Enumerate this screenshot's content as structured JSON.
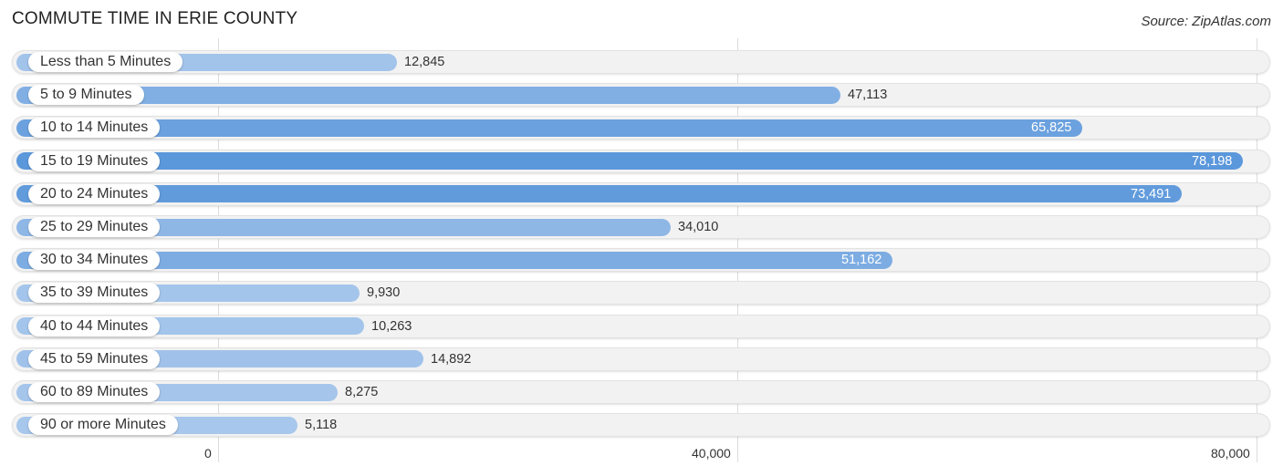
{
  "header": {
    "title": "COMMUTE TIME IN ERIE COUNTY",
    "source": "Source: ZipAtlas.com"
  },
  "chart_data": {
    "type": "bar",
    "orientation": "horizontal",
    "title": "COMMUTE TIME IN ERIE COUNTY",
    "xlabel": "",
    "ylabel": "",
    "categories": [
      "Less than 5 Minutes",
      "5 to 9 Minutes",
      "10 to 14 Minutes",
      "15 to 19 Minutes",
      "20 to 24 Minutes",
      "25 to 29 Minutes",
      "30 to 34 Minutes",
      "35 to 39 Minutes",
      "40 to 44 Minutes",
      "45 to 59 Minutes",
      "60 to 89 Minutes",
      "90 or more Minutes"
    ],
    "values": [
      12845,
      47113,
      65825,
      78198,
      73491,
      34010,
      51162,
      9930,
      10263,
      14892,
      8275,
      5118
    ],
    "value_labels": [
      "12,845",
      "47,113",
      "65,825",
      "78,198",
      "73,491",
      "34,010",
      "51,162",
      "9,930",
      "10,263",
      "14,892",
      "8,275",
      "5,118"
    ],
    "xlim": [
      0,
      80000
    ],
    "x_ticks": [
      0,
      40000,
      80000
    ],
    "x_tick_labels": [
      "0",
      "40,000",
      "80,000"
    ],
    "grid": true,
    "colors": {
      "light": "#a9c8ec",
      "dark": "#5b97db"
    }
  }
}
